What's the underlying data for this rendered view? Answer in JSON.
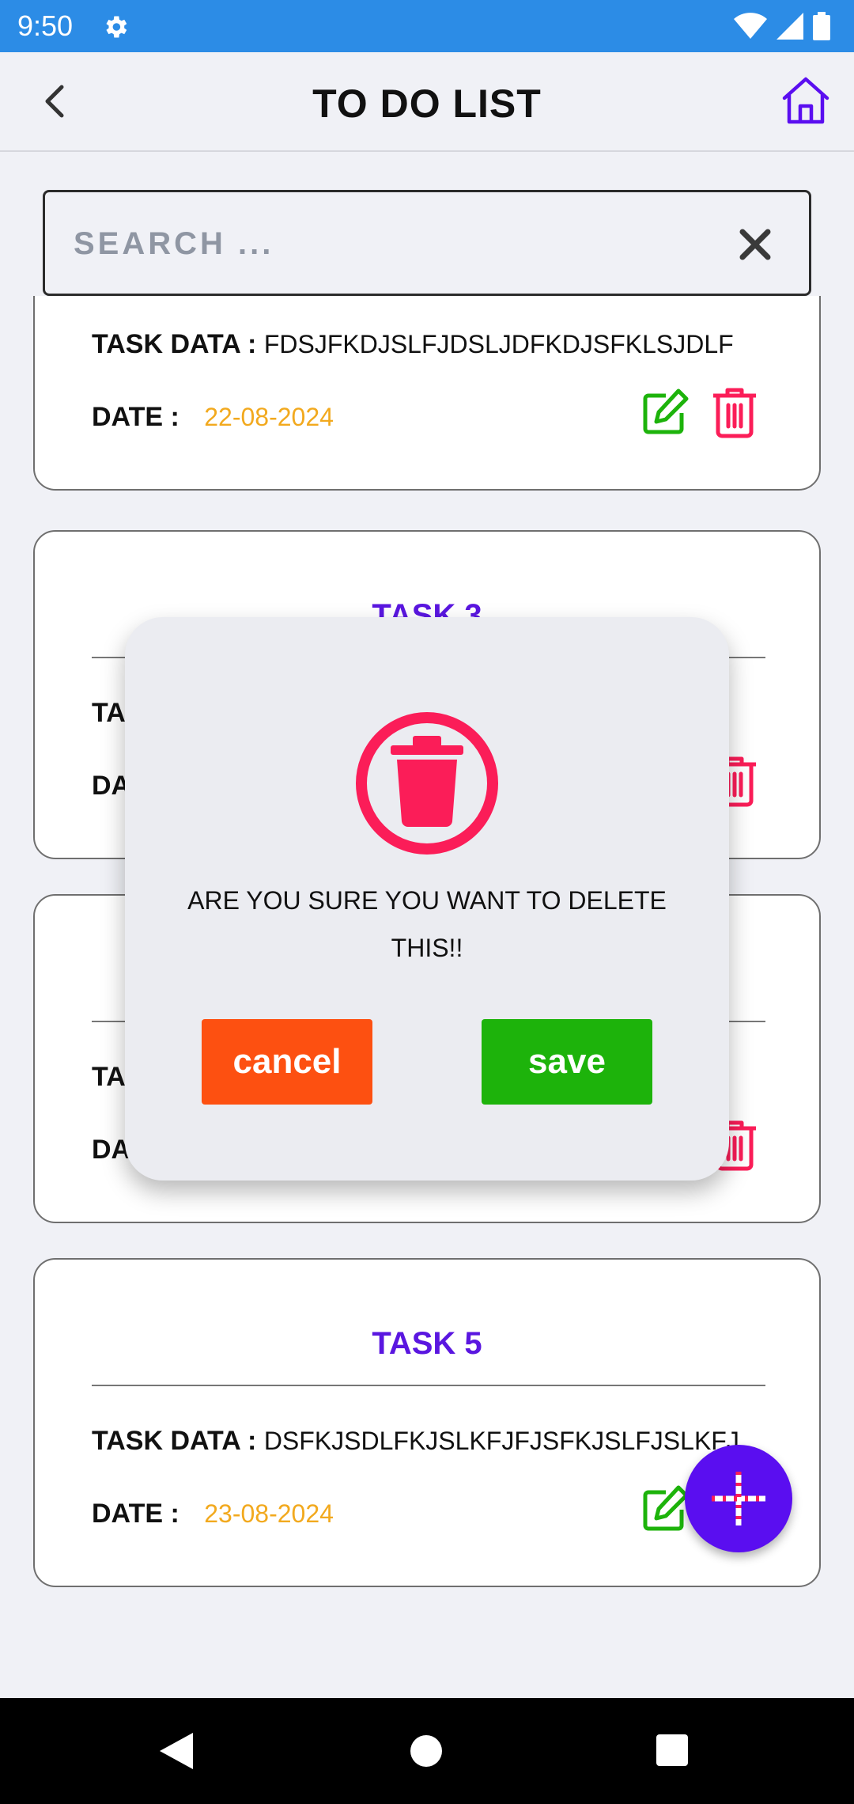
{
  "status_bar": {
    "time": "9:50"
  },
  "header": {
    "title": "TO DO LIST"
  },
  "search": {
    "placeholder": "SEARCH ..."
  },
  "labels": {
    "task_data": "TASK DATA : ",
    "date": "DATE : "
  },
  "tasks": [
    {
      "title": "",
      "data": "FDSJFKDJSLFJDSLJDFKDJSFKLSJDLF",
      "date": "22-08-2024"
    },
    {
      "title": "TASK 3",
      "data": "",
      "date": ""
    },
    {
      "title": "",
      "data": "",
      "date": ""
    },
    {
      "title": "TASK 5",
      "data": "DSFKJSDLFKJSLKFJFJSFKJSLFJSLKFJ",
      "date": "23-08-2024"
    }
  ],
  "dialog": {
    "message": "ARE YOU SURE YOU WANT TO DELETE THIS!!",
    "cancel_label": "cancel",
    "save_label": "save"
  },
  "colors": {
    "status_bar": "#2c8ce6",
    "task_title": "#5a16e0",
    "date": "#f2a91e",
    "edit_icon": "#1db30b",
    "delete_icon": "#fb1d58",
    "cancel_button": "#fd5011",
    "save_button": "#1db30b",
    "fab": "#5a0ef0"
  },
  "icons": {
    "back": "arrow-left",
    "home": "home",
    "clear": "close",
    "edit": "edit-square",
    "delete": "trash",
    "dialog": "trash-circle",
    "fab": "plus-dashed"
  }
}
